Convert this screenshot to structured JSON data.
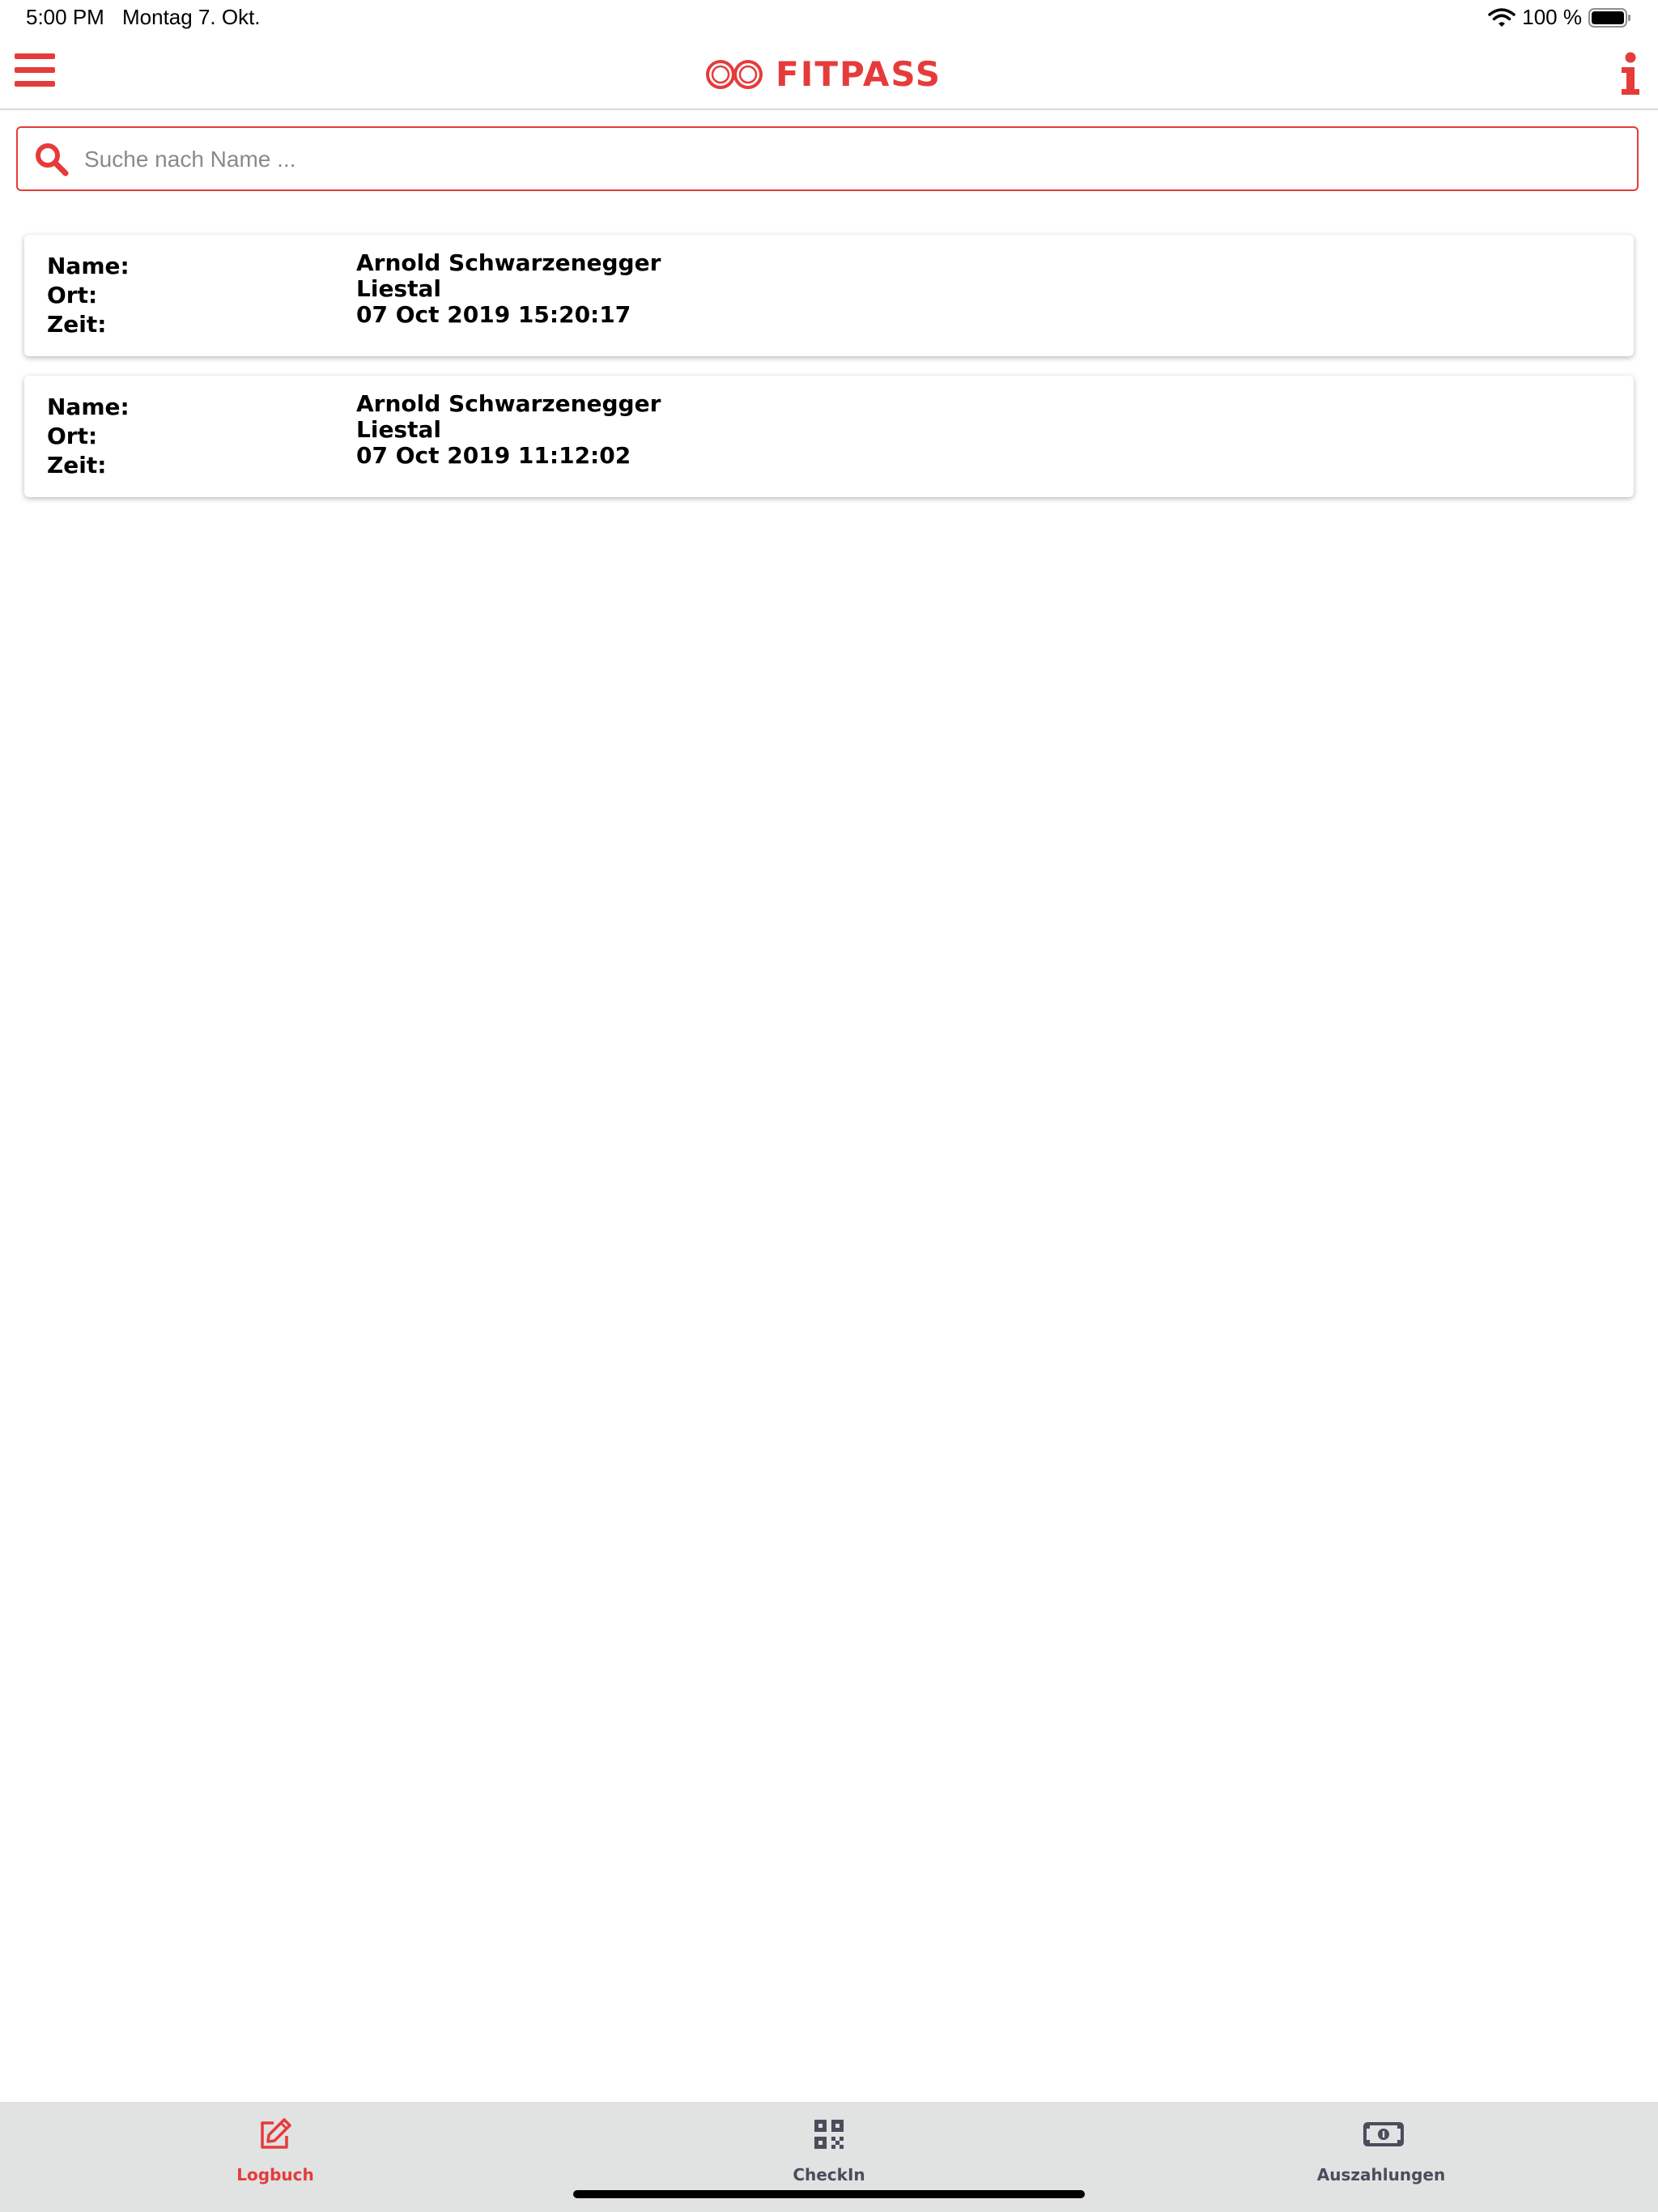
{
  "status_bar": {
    "time": "5:00 PM",
    "date": "Montag 7. Okt.",
    "battery": "100 %"
  },
  "header": {
    "brand": "FITPASS"
  },
  "search": {
    "placeholder": "Suche nach Name ..."
  },
  "entries": [
    {
      "name_label": "Name:",
      "name": "Arnold Schwarzenegger",
      "ort_label": "Ort:",
      "ort": "Liestal",
      "zeit_label": "Zeit:",
      "zeit": "07 Oct 2019 15:20:17"
    },
    {
      "name_label": "Name:",
      "name": "Arnold Schwarzenegger",
      "ort_label": "Ort:",
      "ort": "Liestal",
      "zeit_label": "Zeit:",
      "zeit": "07 Oct 2019 11:12:02"
    }
  ],
  "tabs": [
    {
      "label": "Logbuch",
      "icon": "edit-icon",
      "active": true
    },
    {
      "label": "CheckIn",
      "icon": "qr-code-icon",
      "active": false
    },
    {
      "label": "Auszahlungen",
      "icon": "money-bill-icon",
      "active": false
    }
  ],
  "colors": {
    "accent": "#e63b3b",
    "tab_bar": "#e1e2e2",
    "tab_inactive": "#4a4d5c"
  }
}
